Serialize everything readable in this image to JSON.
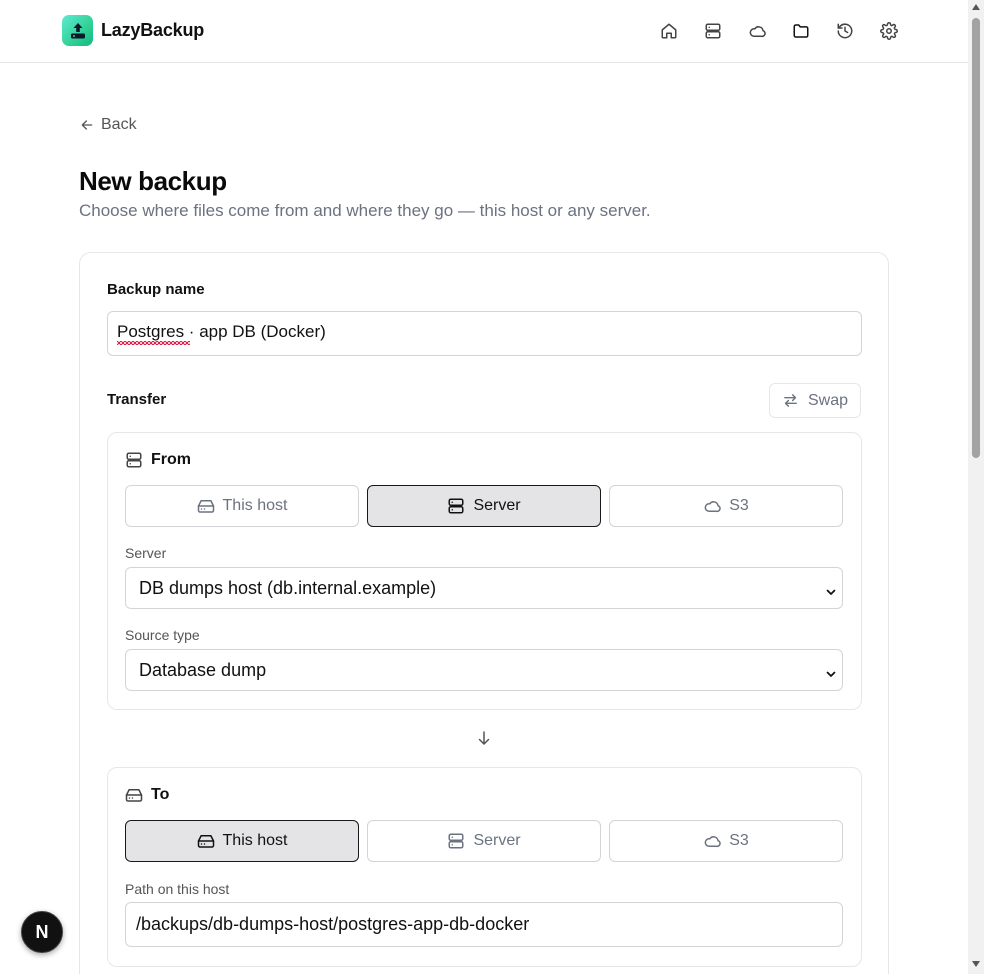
{
  "app": {
    "name": "LazyBackup",
    "logo_icon": "server-upload-logo-icon",
    "accent_gradient": [
      "#5eead4",
      "#10b981"
    ]
  },
  "nav": {
    "items": [
      {
        "icon": "home-icon",
        "active": false
      },
      {
        "icon": "servers-icon",
        "active": false
      },
      {
        "icon": "cloud-icon",
        "active": false
      },
      {
        "icon": "folder-icon",
        "active": true
      },
      {
        "icon": "history-icon",
        "active": false
      },
      {
        "icon": "settings-icon",
        "active": false
      }
    ]
  },
  "page": {
    "back_label": "Back",
    "title": "New backup",
    "subtitle": "Choose where files come from and where they go — this host or any server."
  },
  "form": {
    "name_label": "Backup name",
    "name_value": "Postgres · app DB (Docker)",
    "transfer_label": "Transfer",
    "swap_label": "Swap"
  },
  "from": {
    "title": "From",
    "options": [
      {
        "label": "This host",
        "icon": "drive-icon",
        "selected": false
      },
      {
        "label": "Server",
        "icon": "server-icon",
        "selected": true
      },
      {
        "label": "S3",
        "icon": "cloud-icon",
        "selected": false
      }
    ],
    "server_label": "Server",
    "server_value": "DB dumps host (db.internal.example)",
    "source_type_label": "Source type",
    "source_type_value": "Database dump"
  },
  "to": {
    "title": "To",
    "options": [
      {
        "label": "This host",
        "icon": "drive-icon",
        "selected": true
      },
      {
        "label": "Server",
        "icon": "server-icon",
        "selected": false
      },
      {
        "label": "S3",
        "icon": "cloud-icon",
        "selected": false
      }
    ],
    "path_label": "Path on this host",
    "path_value": "/backups/db-dumps-host/postgres-app-db-docker"
  },
  "devtools": {
    "badge_letter": "N"
  }
}
